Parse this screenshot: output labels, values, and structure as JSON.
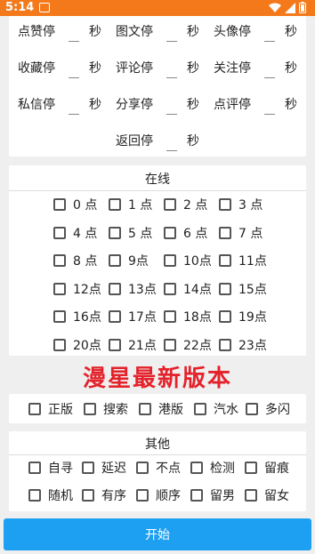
{
  "status_bar": {
    "time": "5:14"
  },
  "stop_settings": {
    "unit": "秒",
    "items": [
      "点赞停",
      "图文停",
      "头像停",
      "收藏停",
      "评论停",
      "关注停",
      "私信停",
      "分享停",
      "点评停",
      "返回停"
    ]
  },
  "online": {
    "title": "在线",
    "hours": [
      "0 点",
      "1 点",
      "2 点",
      "3 点",
      "4 点",
      "5 点",
      "6 点",
      "7 点",
      "8 点",
      "9点",
      "10点",
      "11点",
      "12点",
      "13点",
      "14点",
      "15点",
      "16点",
      "17点",
      "18点",
      "19点",
      "20点",
      "21点",
      "22点",
      "23点"
    ]
  },
  "banner": "漫星最新版本",
  "versions": [
    "正版",
    "搜索",
    "港版",
    "汽水",
    "多闪"
  ],
  "other": {
    "title": "其他",
    "options": [
      "自寻",
      "延迟",
      "不点",
      "检测",
      "留痕",
      "随机",
      "有序",
      "顺序",
      "留男",
      "留女"
    ]
  },
  "start_button": "开始",
  "colors": {
    "status_bar": "#f3791b",
    "start_button": "#1ea0f2",
    "banner": "#e4222b"
  }
}
